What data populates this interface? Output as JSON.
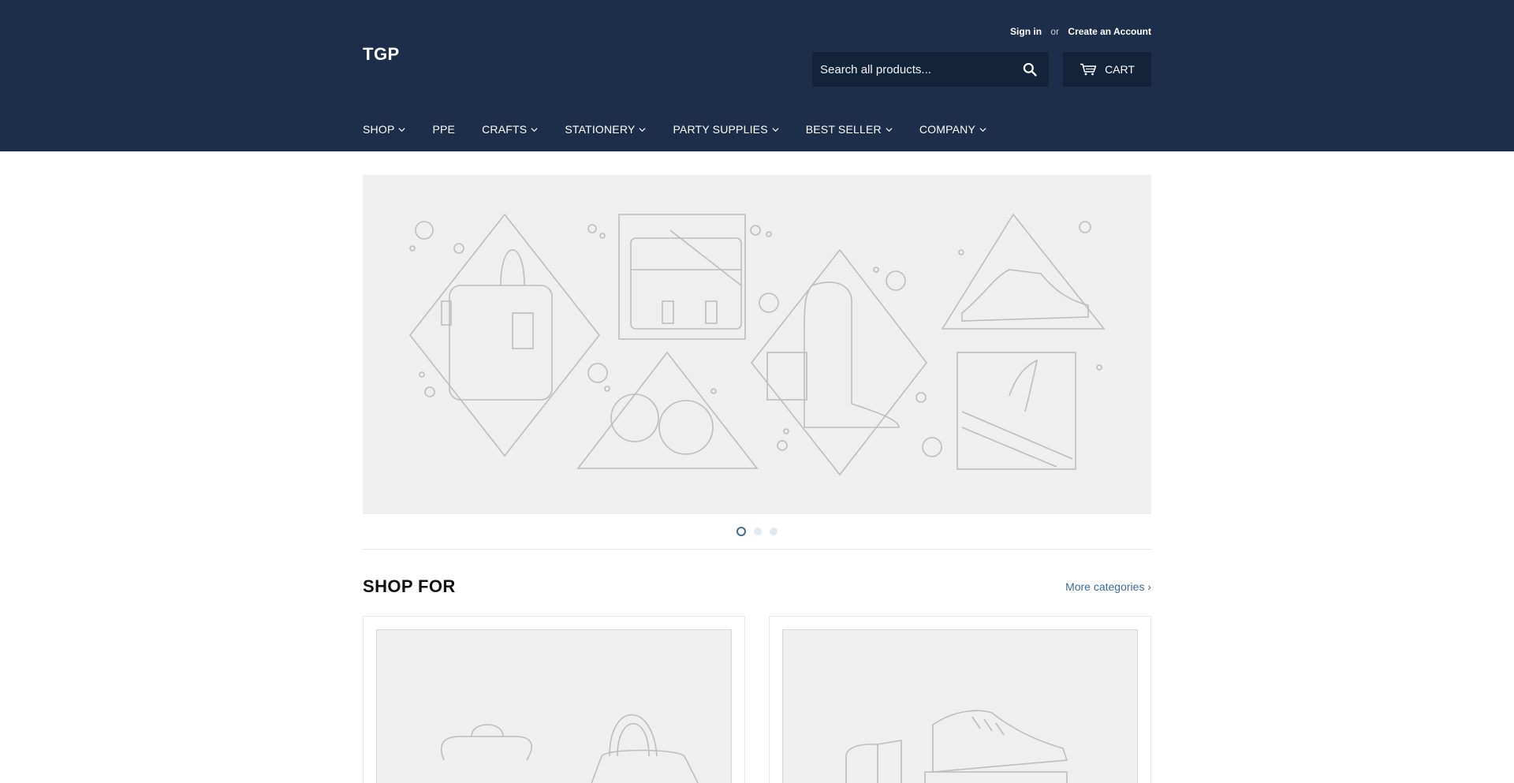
{
  "header": {
    "logo": "TGP",
    "sign_in": "Sign in",
    "or": "or",
    "create_account": "Create an Account",
    "search_placeholder": "Search all products...",
    "cart_label": "CART"
  },
  "nav": {
    "items": [
      {
        "label": "SHOP",
        "dropdown": true
      },
      {
        "label": "PPE",
        "dropdown": false
      },
      {
        "label": "CRAFTS",
        "dropdown": true
      },
      {
        "label": "STATIONERY",
        "dropdown": true
      },
      {
        "label": "PARTY SUPPLIES",
        "dropdown": true
      },
      {
        "label": "BEST SELLER",
        "dropdown": true
      },
      {
        "label": "COMPANY",
        "dropdown": true
      }
    ]
  },
  "slideshow": {
    "active_index": 0,
    "slide_count": 3
  },
  "shop_for": {
    "title": "SHOP FOR",
    "more_link": "More categories ›"
  },
  "colors": {
    "header_bg": "#1c2e4a",
    "accent": "#3d6c97",
    "placeholder_bg": "#efefef"
  }
}
